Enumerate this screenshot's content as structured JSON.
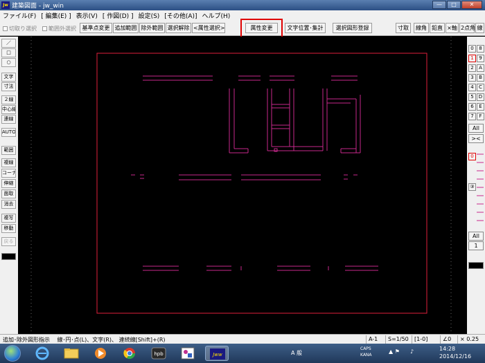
{
  "window": {
    "app_icon_text": "Jw",
    "title": "建築図面 - jw_win",
    "buttons": {
      "minimize": "—",
      "maximize": "□",
      "close": "✕"
    }
  },
  "menu": [
    "ファイル(F)",
    "[ 編集(E) ]",
    "表示(V)",
    "[ 作図(D) ]",
    "設定(S)",
    "[その他(A)]",
    "ヘルプ(H)"
  ],
  "toolbar": {
    "check_cut": "切取り選択",
    "check_outside": "範囲外選択",
    "btn_base_point": "基準点変更",
    "btn_add_range": "追加範囲",
    "btn_exclude_range": "除外範囲",
    "btn_clear_selection": "選択解除",
    "btn_attr_select": "<属性選択>",
    "btn_attr_change": "属性変更",
    "btn_text_position": "文字位置･集計",
    "btn_register_shape": "選択図形登録",
    "btn_dim": "寸取",
    "btn_line_angle": "線角",
    "btn_vertical": "鉛直",
    "btn_x_axis": "×軸",
    "btn_2angle": "2点角",
    "btn_line_length": "線"
  },
  "left_tools": [
    {
      "label": "／",
      "gray": false
    },
    {
      "label": "□",
      "gray": false
    },
    {
      "label": "○",
      "gray": false
    },
    {
      "label": "文字",
      "gray": false
    },
    {
      "label": "寸法",
      "gray": false
    },
    {
      "label": "２線",
      "gray": false
    },
    {
      "label": "中心線",
      "gray": false
    },
    {
      "label": "連線",
      "gray": false
    },
    {
      "label": "AUTO",
      "gray": false
    },
    {
      "label": "範囲",
      "gray": false
    },
    {
      "label": "複線",
      "gray": false
    },
    {
      "label": "コーナー",
      "gray": false
    },
    {
      "label": "伸縮",
      "gray": false
    },
    {
      "label": "面取",
      "gray": false
    },
    {
      "label": "消去",
      "gray": false
    },
    {
      "label": "複写",
      "gray": false
    },
    {
      "label": "移動",
      "gray": false
    },
    {
      "label": "戻る",
      "gray": true
    }
  ],
  "layer_groups": {
    "row1": [
      "0",
      "8"
    ],
    "row2": [
      "1",
      "9"
    ],
    "row3": [
      "2",
      "A"
    ],
    "row4": [
      "3",
      "B"
    ],
    "row5": [
      "4",
      "C"
    ],
    "row6": [
      "5",
      "D"
    ],
    "row7": [
      "6",
      "E"
    ],
    "row8": [
      "7",
      "F"
    ],
    "all": "All",
    "swap": "><",
    "layer_0": "0",
    "layer_3": "③",
    "all2": "All",
    "num": "1"
  },
  "status": {
    "message": "追加･除外図形指示　 線･円･点(L)、文字(R)、 連続線[Shift]+(R)",
    "paper": "A-1",
    "scale": "S=1/50",
    "layer": "[1-0]",
    "angle": "∠0",
    "magnification": "× 0.25"
  },
  "taskbar": {
    "clock_time": "14:28",
    "clock_date": "2014/12/16",
    "ime": "A 般",
    "caps": "CAPS",
    "kana": "KANA"
  },
  "colors": {
    "drawing_line": "#c8288c",
    "frame_line": "#e0203c",
    "highlight": "#e00000"
  }
}
